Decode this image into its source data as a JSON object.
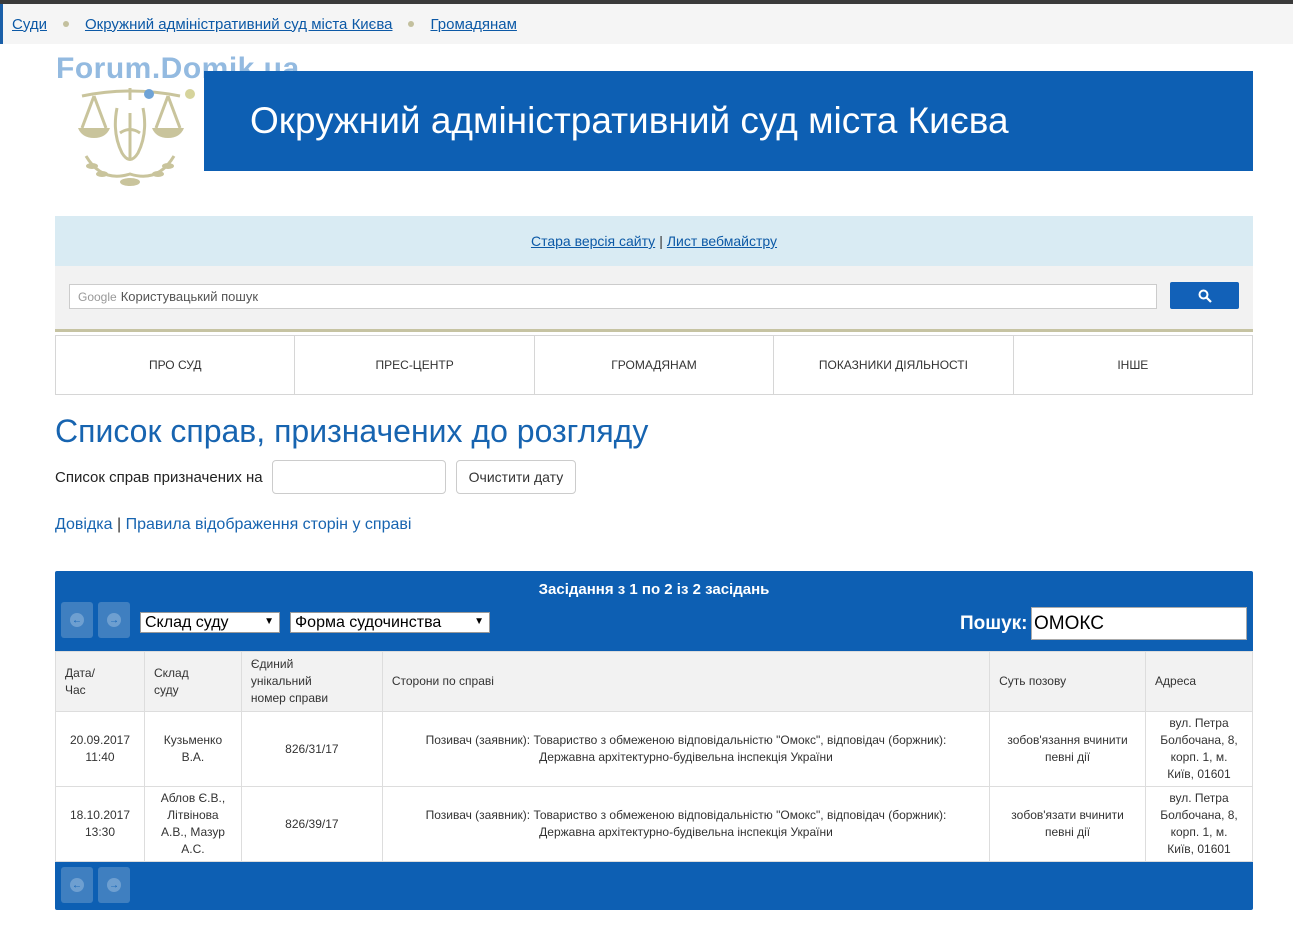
{
  "breadcrumb": {
    "items": [
      "Суди",
      "Окружний адміністративний суд міста Києва",
      "Громадянам"
    ]
  },
  "watermark": "Forum.Domik.ua",
  "banner": {
    "title": "Окружний адміністративний суд міста Києва"
  },
  "infobar": {
    "old_version": "Стара версія сайту",
    "pipe": "|",
    "webmaster": "Лист вебмайстру"
  },
  "search": {
    "google_label": "Google",
    "placeholder": "Користувацький пошук",
    "icon": "search-icon"
  },
  "nav": {
    "items": [
      "ПРО СУД",
      "ПРЕС-ЦЕНТР",
      "ГРОМАДЯНАМ",
      "ПОКАЗНИКИ ДІЯЛЬНОСТІ",
      "ІНШЕ"
    ]
  },
  "page": {
    "title": "Список справ, призначених до розгляду",
    "date_label": "Список справ призначених на",
    "date_value": "",
    "clear_button": "Очистити дату",
    "help_link": "Довідка",
    "help_sep": "|",
    "rules_link": "Правила відображення сторін у справі"
  },
  "hearings": {
    "summary": "Засідання з 1 по 2 із 2 засідань",
    "filter_court": "Склад суду",
    "filter_form": "Форма судочинства",
    "search_label": "Пошук:",
    "search_value": "ОМОКС",
    "columns": [
      [
        "Дата/",
        "Час"
      ],
      [
        "Склад",
        "суду"
      ],
      [
        "Єдиний",
        "унікальний",
        "номер справи"
      ],
      [
        "Сторони по справі"
      ],
      [
        "Суть позову"
      ],
      [
        "Адреса"
      ]
    ],
    "rows": [
      {
        "date": "20.09.2017",
        "time": "11:40",
        "judges": [
          "Кузьменко",
          "В.А."
        ],
        "case_number": "826/31/17",
        "parties": [
          "Позивач (заявник): Товариство з обмеженою відповідальністю \"Омокс\", відповідач (боржник):",
          "Державна архітектурно-будівельна інспекція України"
        ],
        "claim": [
          "зобов'язання вчинити",
          "певні дії"
        ],
        "address": [
          "вул. Петра",
          "Болбочана, 8,",
          "корп. 1, м.",
          "Київ, 01601"
        ]
      },
      {
        "date": "18.10.2017",
        "time": "13:30",
        "judges": [
          "Аблов Є.В.,",
          "Літвінова",
          "А.В., Мазур",
          "А.С."
        ],
        "case_number": "826/39/17",
        "parties": [
          "Позивач (заявник): Товариство з обмеженою відповідальністю \"Омокс\", відповідач (боржник):",
          "Державна архітектурно-будівельна інспекція України"
        ],
        "claim": [
          "зобов'язати вчинити",
          "певні дії"
        ],
        "address": [
          "вул. Петра",
          "Болбочана, 8,",
          "корп. 1, м.",
          "Київ, 01601"
        ]
      }
    ]
  },
  "colors": {
    "primary": "#0d5fb3",
    "link": "#0c59a6",
    "info_bg": "#d9ebf3",
    "accent_line": "#c6c3a2"
  }
}
